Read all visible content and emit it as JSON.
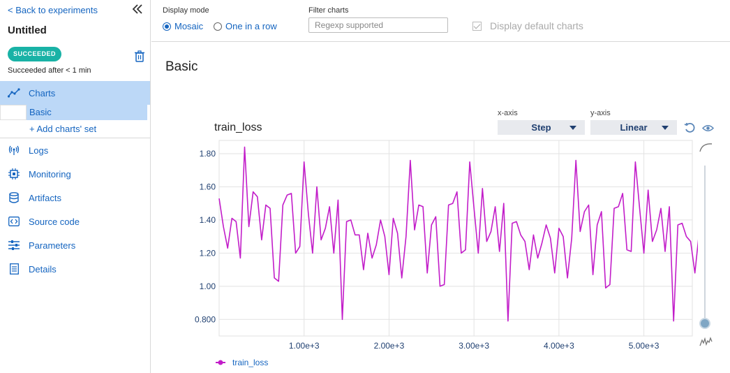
{
  "sidebar": {
    "back_label": "< Back to experiments",
    "run_title": "Untitled",
    "status_badge": "SUCCEEDED",
    "status_text": "Succeeded after < 1 min",
    "nav": {
      "charts": "Charts",
      "charts_sub": "Basic",
      "add_set": "+ Add charts' set",
      "logs": "Logs",
      "monitoring": "Monitoring",
      "artifacts": "Artifacts",
      "source_code": "Source code",
      "parameters": "Parameters",
      "details": "Details"
    }
  },
  "topbar": {
    "display_mode_label": "Display mode",
    "mode_mosaic": "Mosaic",
    "mode_row": "One in a row",
    "selected_mode": "Mosaic",
    "filter_label": "Filter charts",
    "filter_placeholder": "Regexp supported",
    "filter_value": "",
    "default_charts_label": "Display default charts",
    "default_charts_checked": true
  },
  "section_title": "Basic",
  "chart_panel": {
    "title": "train_loss",
    "xaxis_label": "x-axis",
    "xaxis_value": "Step",
    "yaxis_label": "y-axis",
    "yaxis_value": "Linear"
  },
  "colors": {
    "accent": "#1565c0",
    "badge": "#19b2a6",
    "series": "#c21dc9",
    "active_nav": "#bcd8f7"
  },
  "chart_data": {
    "type": "line",
    "title": "train_loss",
    "xlabel": "",
    "ylabel": "",
    "xlim": [
      0,
      5570
    ],
    "ylim": [
      0.7,
      1.88
    ],
    "grid": true,
    "legend_placement": "bottom-left",
    "x_ticks": [
      1000,
      2000,
      3000,
      4000,
      5000
    ],
    "x_tick_labels": [
      "1.00e+3",
      "2.00e+3",
      "3.00e+3",
      "4.00e+3",
      "5.00e+3"
    ],
    "y_ticks": [
      0.8,
      1.0,
      1.2,
      1.4,
      1.6,
      1.8
    ],
    "y_tick_labels": [
      "0.800",
      "1.00",
      "1.20",
      "1.40",
      "1.60",
      "1.80"
    ],
    "series": [
      {
        "name": "train_loss",
        "x_step": 50,
        "values": [
          1.53,
          1.36,
          1.23,
          1.41,
          1.39,
          1.17,
          1.84,
          1.36,
          1.57,
          1.54,
          1.28,
          1.49,
          1.47,
          1.05,
          1.03,
          1.49,
          1.55,
          1.56,
          1.2,
          1.24,
          1.75,
          1.44,
          1.2,
          1.6,
          1.28,
          1.35,
          1.48,
          1.2,
          1.52,
          0.8,
          1.39,
          1.4,
          1.31,
          1.31,
          1.1,
          1.32,
          1.17,
          1.25,
          1.4,
          1.3,
          1.07,
          1.41,
          1.32,
          1.05,
          1.3,
          1.76,
          1.34,
          1.49,
          1.48,
          1.08,
          1.37,
          1.42,
          1.0,
          1.01,
          1.49,
          1.5,
          1.57,
          1.2,
          1.22,
          1.75,
          1.47,
          1.2,
          1.59,
          1.27,
          1.33,
          1.48,
          1.21,
          1.5,
          0.79,
          1.38,
          1.39,
          1.31,
          1.27,
          1.1,
          1.31,
          1.17,
          1.26,
          1.37,
          1.29,
          1.08,
          1.35,
          1.3,
          1.05,
          1.29,
          1.76,
          1.33,
          1.45,
          1.49,
          1.07,
          1.37,
          1.45,
          0.99,
          1.01,
          1.47,
          1.48,
          1.56,
          1.22,
          1.21,
          1.75,
          1.47,
          1.2,
          1.58,
          1.27,
          1.34,
          1.47,
          1.21,
          1.48,
          0.79,
          1.37,
          1.38,
          1.3,
          1.27,
          1.08,
          1.32,
          1.16
        ]
      }
    ]
  }
}
